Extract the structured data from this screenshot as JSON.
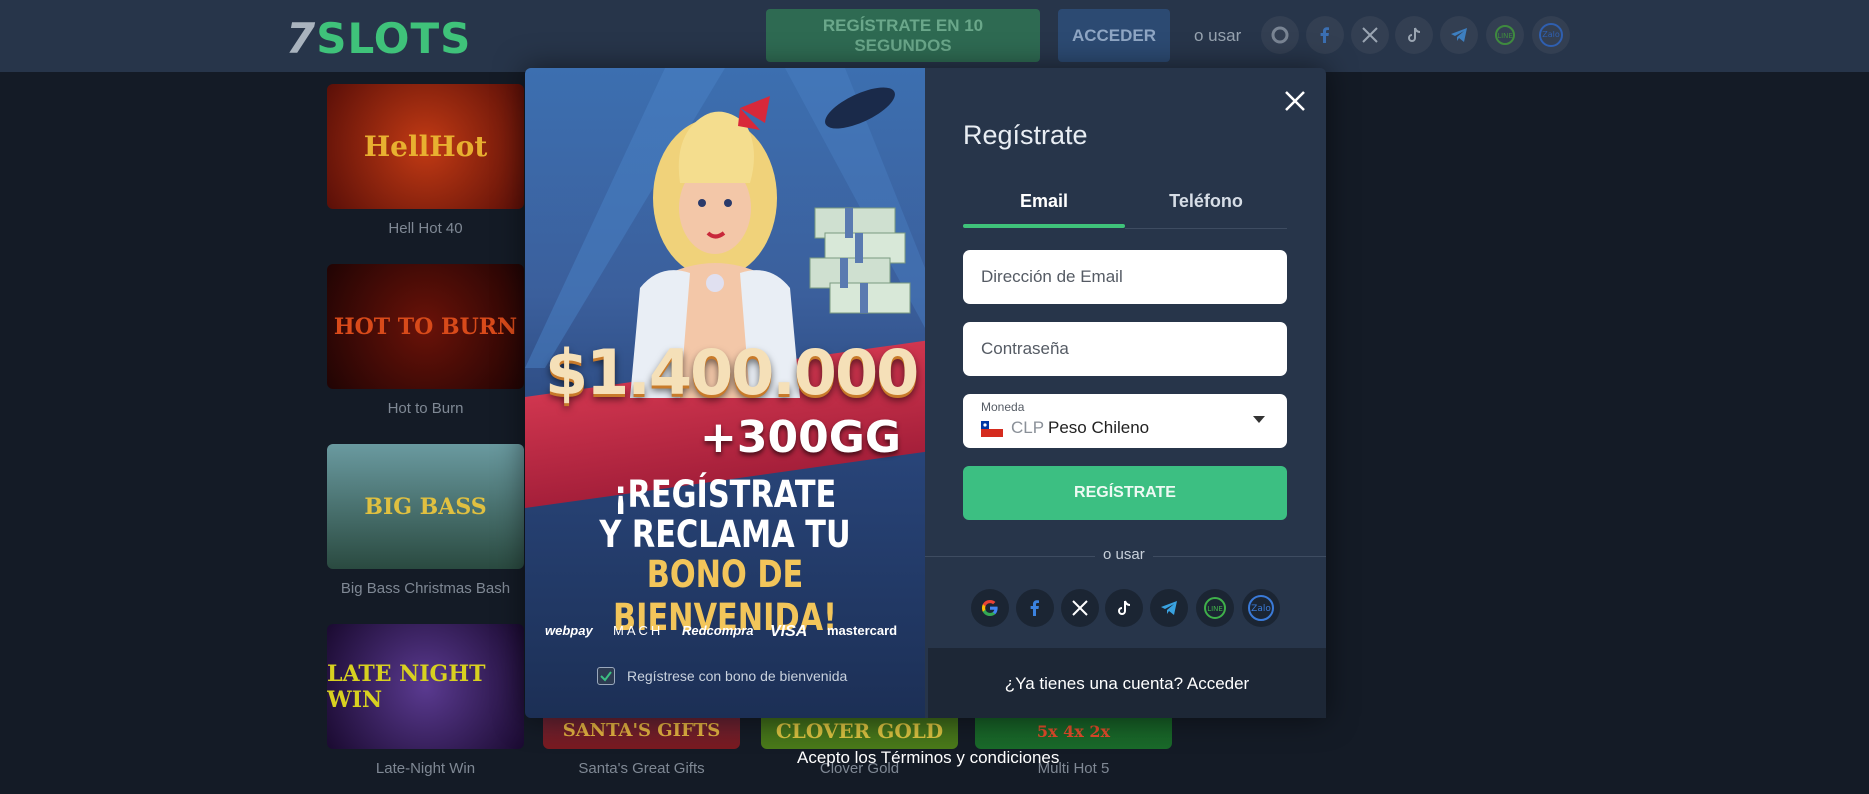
{
  "header": {
    "logo_seven": "7",
    "logo_slots": "SLOTS",
    "register_label": "REGÍSTRATE EN 10 SEGUNDOS",
    "login_label": "ACCEDER",
    "or_use": "o usar"
  },
  "games": [
    {
      "title": "Hell Hot 40",
      "art": "HellHot"
    },
    {
      "title": "Hot to Burn",
      "art": "HOT TO BURN"
    },
    {
      "title": "Big Bass Christmas Bash",
      "art": "BIG BASS"
    },
    {
      "title": "Late-Night Win",
      "art": "LATE NIGHT WIN"
    },
    {
      "title": "Santa's Great Gifts",
      "art": "SANTA'S GIFTS"
    },
    {
      "title": "Clover Gold",
      "art": "CLOVER GOLD"
    },
    {
      "title": "Multi Hot 5",
      "art": "5x 4x 2x"
    }
  ],
  "promo": {
    "amount": "$1.400.000",
    "bonus": "+300GG",
    "line1": "¡REGÍSTRATE",
    "line2": "Y RECLAMA TU",
    "line3": "BONO DE BIENVENIDA!",
    "payments": [
      "webpay",
      "MACH",
      "Redcompra",
      "VISA",
      "mastercard"
    ],
    "bonus_checkbox_label": "Regístrese con bono de bienvenida",
    "bonus_checked": true
  },
  "form": {
    "title": "Regístrate",
    "tabs": [
      "Email",
      "Teléfono"
    ],
    "active_tab": "Email",
    "email_placeholder": "Dirección de Email",
    "password_placeholder": "Contraseña",
    "currency_label": "Moneda",
    "currency_code": "CLP",
    "currency_name": "Peso Chileno",
    "submit_label": "REGÍSTRATE",
    "or_use": "o usar",
    "social": [
      "google-icon",
      "facebook-icon",
      "x-icon",
      "tiktok-icon",
      "telegram-icon",
      "line-icon",
      "zalo-icon"
    ],
    "have_account": "¿Ya tienes una cuenta?",
    "login_link": "Acceder"
  },
  "terms": "Acepto los Términos y condiciones",
  "colors": {
    "accent": "#3cbf82",
    "background": "#1a2230",
    "panel": "#27354a"
  }
}
